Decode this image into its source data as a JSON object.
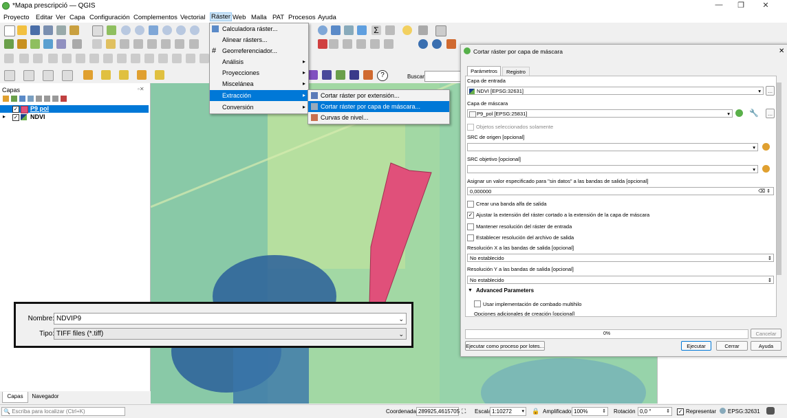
{
  "window": {
    "title": "*Mapa prescripció — QGIS",
    "min": "—",
    "max": "❐",
    "close": "✕"
  },
  "menubar": [
    "Proyecto",
    "Editar",
    "Ver",
    "Capa",
    "Configuración",
    "Complementos",
    "Vectorial",
    "Ráster",
    "Web",
    "Malla",
    "PAT",
    "Procesos",
    "Ayuda"
  ],
  "raster_menu": {
    "items": [
      "Calculadora ráster...",
      "Alinear rásters...",
      "Georreferenciador...",
      "Análisis",
      "Proyecciones",
      "Miscelánea",
      "Extracción",
      "Conversión"
    ],
    "submenu": [
      "Cortar ráster por extensión...",
      "Cortar ráster por capa de máscara...",
      "Curvas de nivel..."
    ]
  },
  "toolbar": {
    "search_label": "Buscar"
  },
  "layers": {
    "title": "Capas",
    "items": [
      {
        "name": "P9 pol",
        "checked": "✓",
        "color": "#e0507a"
      },
      {
        "name": "NDVI",
        "checked": "✓"
      }
    ],
    "tabs": [
      "Capas",
      "Navegador"
    ],
    "locate_placeholder": "Escriba para localizar (Ctrl+K)"
  },
  "dialog": {
    "title": "Cortar ráster por capa de máscara",
    "tabs": [
      "Parámetros",
      "Registro"
    ],
    "input_label": "Capa de entrada",
    "input_value": "NDVI [EPSG:32631]",
    "mask_label": "Capa de máscara",
    "mask_value": "P9_pol [EPSG:25831]",
    "selected_only": "Objetos seleccionados solamente",
    "src_origin_label": "SRC de origen [opcional]",
    "src_target_label": "SRC objetivo [opcional]",
    "nodata_label": "Asignar un valor especificado para \"sin datos\" a las bandas de salida [opcional]",
    "nodata_value": "0,000000",
    "alpha_band": "Crear una banda alfa de salida",
    "adjust_extent": "Ajustar la extensión del ráster cortado a la extensión de la capa de máscara",
    "keep_resolution": "Mantener resolución del ráster de entrada",
    "set_resolution": "Establecer resolución del archivo de salida",
    "res_x_label": "Resolución X a las bandas de salida [opcional]",
    "res_x_value": "No establecido",
    "res_y_label": "Resolución Y a las bandas de salida [opcional]",
    "res_y_value": "No establecido",
    "advanced": "Advanced Parameters",
    "multithread": "Usar implementación de combado multihilo",
    "creation_opts": "Opciones adicionales de creación [opcional]",
    "progress": "0%",
    "progress_value": 0,
    "cancel": "Cancelar",
    "batch": "Ejecutar como proceso por lotes...",
    "run": "Ejecutar",
    "close": "Cerrar",
    "help": "Ayuda"
  },
  "save_dialog": {
    "name_label": "Nombre:",
    "name_value": "NDVIP9",
    "type_label": "Tipo:",
    "type_value": "TIFF files (*.tiff)"
  },
  "statusbar": {
    "coord_label": "Coordenada",
    "coord_value": "289925,4615705",
    "scale_label": "Escala",
    "scale_value": "1:10272",
    "magnifier_label": "Amplificador",
    "magnifier_value": "100%",
    "rotation_label": "Rotación",
    "rotation_value": "0,0 °",
    "render_label": "Representar",
    "crs": "EPSG:32631"
  },
  "colors": {
    "accent": "#0078d7",
    "polygon": "#e0507a",
    "menu_bg": "#f2f2f2"
  }
}
